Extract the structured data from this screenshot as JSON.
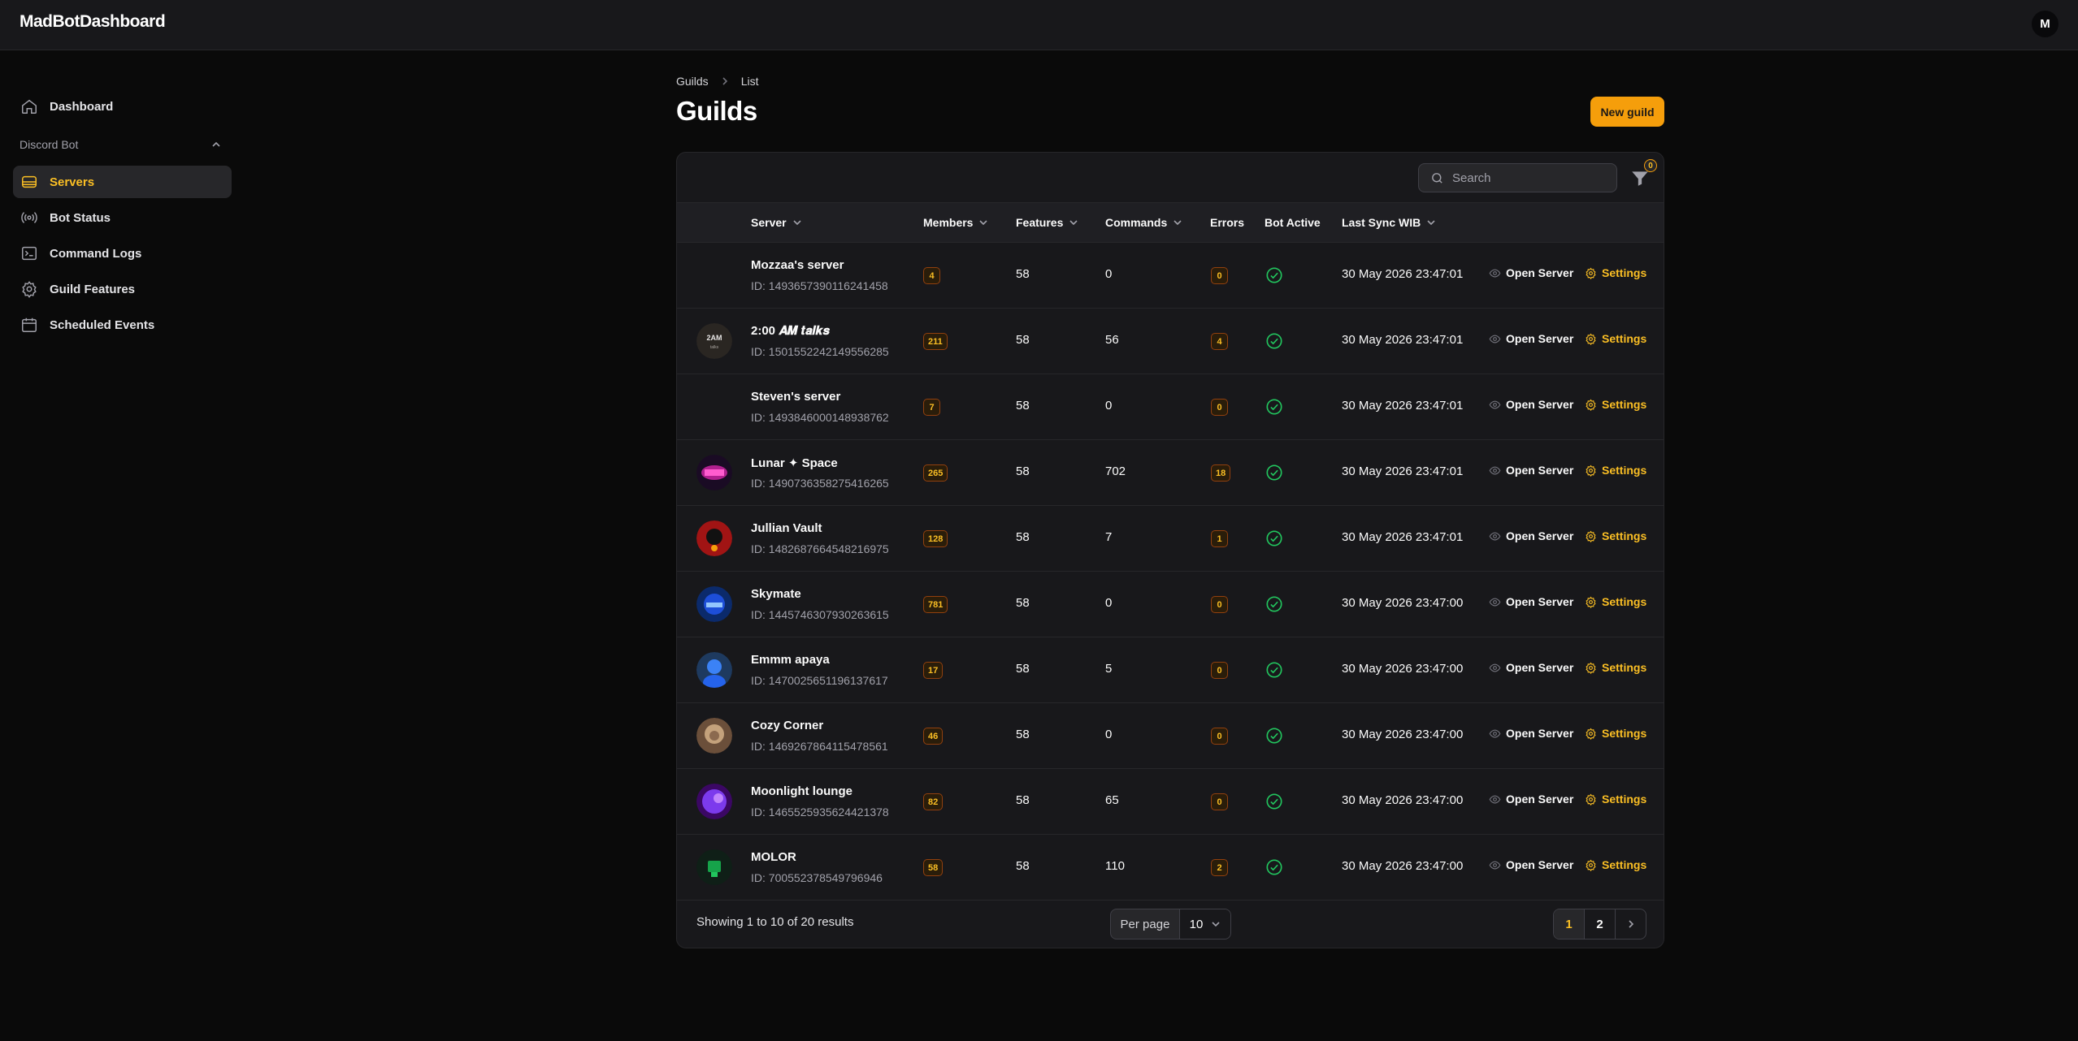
{
  "app": {
    "brand": "MadBotDashboard",
    "user_initial": "M"
  },
  "sidebar": {
    "dashboard": "Dashboard",
    "group_label": "Discord Bot",
    "items": [
      {
        "label": "Servers",
        "icon": "server-icon",
        "active": true
      },
      {
        "label": "Bot Status",
        "icon": "signal-icon",
        "active": false
      },
      {
        "label": "Command Logs",
        "icon": "terminal-icon",
        "active": false
      },
      {
        "label": "Guild Features",
        "icon": "gear-icon",
        "active": false
      },
      {
        "label": "Scheduled Events",
        "icon": "calendar-icon",
        "active": false
      }
    ]
  },
  "breadcrumb": {
    "root": "Guilds",
    "current": "List"
  },
  "page": {
    "title": "Guilds",
    "new_button": "New guild"
  },
  "table": {
    "search_placeholder": "Search",
    "filter_count": "0",
    "columns": {
      "server": "Server",
      "members": "Members",
      "features": "Features",
      "commands": "Commands",
      "errors": "Errors",
      "bot_active": "Bot Active",
      "last_sync": "Last Sync WIB"
    },
    "actions": {
      "open": "Open Server",
      "settings": "Settings"
    },
    "rows": [
      {
        "name": "Mozzaa's server",
        "id": "ID: 1493657390116241458",
        "members": "4",
        "features": "58",
        "commands": "0",
        "errors": "0",
        "sync": "30 May 2026 23:47:01",
        "avatar": "none"
      },
      {
        "name": "2:00 𝑨𝑴 𝒕𝒂𝒍𝒌𝒔",
        "id": "ID: 1501552242149556285",
        "members": "211",
        "features": "58",
        "commands": "56",
        "errors": "4",
        "sync": "30 May 2026 23:47:01",
        "avatar": "2am"
      },
      {
        "name": "Steven's server",
        "id": "ID: 1493846000148938762",
        "members": "7",
        "features": "58",
        "commands": "0",
        "errors": "0",
        "sync": "30 May 2026 23:47:01",
        "avatar": "none"
      },
      {
        "name": "Lunar ✦ Space",
        "id": "ID: 1490736358275416265",
        "members": "265",
        "features": "58",
        "commands": "702",
        "errors": "18",
        "sync": "30 May 2026 23:47:01",
        "avatar": "lunar"
      },
      {
        "name": "Jullian Vault",
        "id": "ID: 1482687664548216975",
        "members": "128",
        "features": "58",
        "commands": "7",
        "errors": "1",
        "sync": "30 May 2026 23:47:01",
        "avatar": "jullian"
      },
      {
        "name": "Skymate",
        "id": "ID: 1445746307930263615",
        "members": "781",
        "features": "58",
        "commands": "0",
        "errors": "0",
        "sync": "30 May 2026 23:47:00",
        "avatar": "skymate"
      },
      {
        "name": "Emmm apaya",
        "id": "ID: 1470025651196137617",
        "members": "17",
        "features": "58",
        "commands": "5",
        "errors": "0",
        "sync": "30 May 2026 23:47:00",
        "avatar": "emmm"
      },
      {
        "name": "Cozy Corner",
        "id": "ID: 1469267864115478561",
        "members": "46",
        "features": "58",
        "commands": "0",
        "errors": "0",
        "sync": "30 May 2026 23:47:00",
        "avatar": "cozy"
      },
      {
        "name": "Moonlight lounge",
        "id": "ID: 1465525935624421378",
        "members": "82",
        "features": "58",
        "commands": "65",
        "errors": "0",
        "sync": "30 May 2026 23:47:00",
        "avatar": "moonlight"
      },
      {
        "name": "MOLOR",
        "id": "ID: 700552378549796946",
        "members": "58",
        "features": "58",
        "commands": "110",
        "errors": "2",
        "sync": "30 May 2026 23:47:00",
        "avatar": "molor"
      }
    ]
  },
  "footer": {
    "results_text": "Showing 1 to 10 of 20 results",
    "per_page_label": "Per page",
    "per_page_value": "10",
    "pages": [
      "1",
      "2"
    ],
    "current_page": "1"
  },
  "colors": {
    "accent": "#f59e0b",
    "background": "#0a0a0a",
    "panel": "#18181b",
    "success": "#22c55e"
  }
}
